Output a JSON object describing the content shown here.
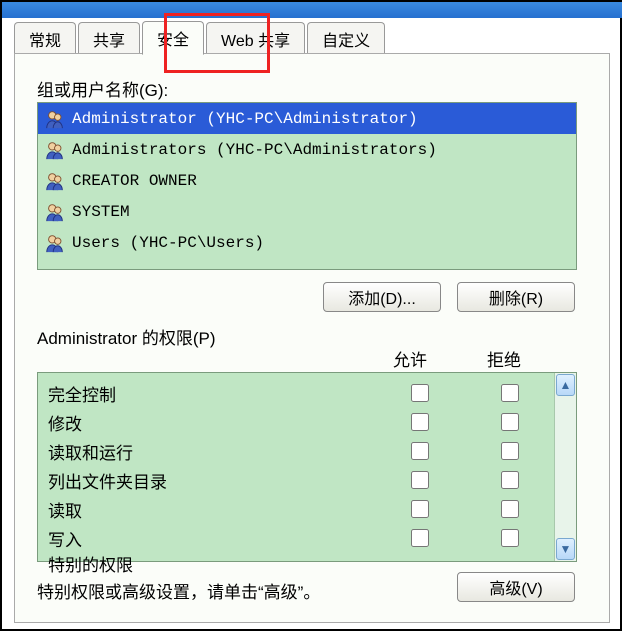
{
  "tabs": {
    "general": "常规",
    "sharing": "共享",
    "security": "安全",
    "web_sharing": "Web 共享",
    "customize": "自定义"
  },
  "group_label": "组或用户名称(G):",
  "users": [
    {
      "label": "Administrator (YHC-PC\\Administrator)",
      "selected": true
    },
    {
      "label": "Administrators (YHC-PC\\Administrators)",
      "selected": false
    },
    {
      "label": "CREATOR OWNER",
      "selected": false
    },
    {
      "label": "SYSTEM",
      "selected": false
    },
    {
      "label": "Users (YHC-PC\\Users)",
      "selected": false
    }
  ],
  "buttons": {
    "add": "添加(D)...",
    "remove": "删除(R)",
    "advanced": "高级(V)"
  },
  "perm_for_label": "Administrator 的权限(P)",
  "columns": {
    "allow": "允许",
    "deny": "拒绝"
  },
  "permissions": [
    {
      "name": "完全控制"
    },
    {
      "name": "修改"
    },
    {
      "name": "读取和运行"
    },
    {
      "name": "列出文件夹目录"
    },
    {
      "name": "读取"
    },
    {
      "name": "写入"
    },
    {
      "name": "特别的权限"
    }
  ],
  "footer": "特别权限或高级设置，请单击“高级”。"
}
